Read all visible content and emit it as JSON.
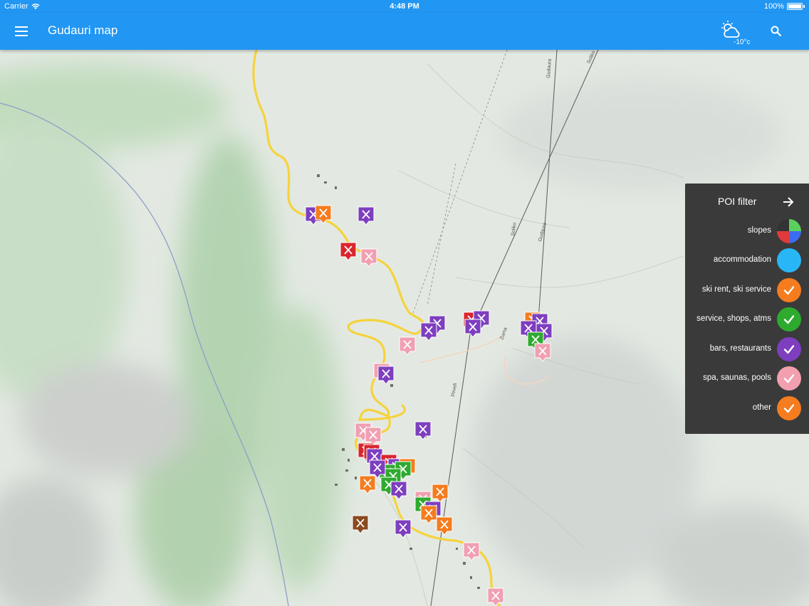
{
  "status_bar": {
    "carrier": "Carrier",
    "time": "4:48 PM",
    "battery": "100%"
  },
  "app_bar": {
    "title": "Gudauri map",
    "weather_temp": "-10°c",
    "menu_icon": "hamburger-menu-icon",
    "search_icon": "search-icon",
    "weather_icon": "partly-cloudy-icon"
  },
  "poi_filter": {
    "title": "POI filter",
    "items": [
      {
        "label": "slopes",
        "color": "multi",
        "checked": false
      },
      {
        "label": "accommodation",
        "color": "#29b6f6",
        "checked": false
      },
      {
        "label": "ski rent, ski service",
        "color": "#f57c1f",
        "checked": true
      },
      {
        "label": "service, shops, atms",
        "color": "#2eaa2e",
        "checked": true
      },
      {
        "label": "bars, restaurants",
        "color": "#7e3fbf",
        "checked": true
      },
      {
        "label": "spa, saunas, pools",
        "color": "#f2a0b0",
        "checked": true
      },
      {
        "label": "other",
        "color": "#f57c1f",
        "checked": true
      }
    ]
  },
  "colors": {
    "primary": "#2196f3",
    "panel_bg": "#3a3a3a",
    "road": "#f5d33c"
  },
  "map_labels": [
    "Gudaura",
    "Soliko",
    "Zuma",
    "Pirveli",
    "Soliko",
    "Gudaura"
  ]
}
